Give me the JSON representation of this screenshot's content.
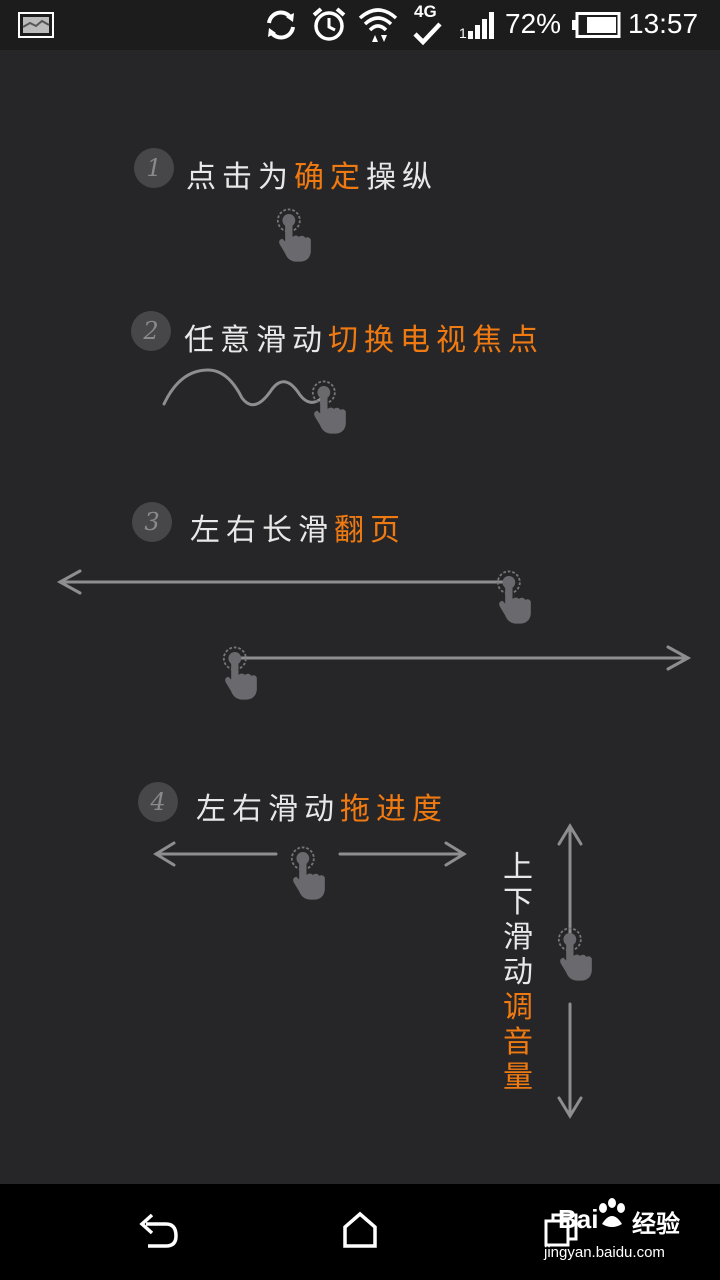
{
  "status_bar": {
    "network": "4G",
    "battery": "72%",
    "time": "13:57",
    "icons": [
      "image-notification-icon",
      "sync-icon",
      "alarm-icon",
      "wifi-icon",
      "4g-data-icon",
      "signal-icon",
      "battery-icon"
    ]
  },
  "steps": [
    {
      "num": "1",
      "text": "点击为",
      "highlight": "确定",
      "suffix": "操纵"
    },
    {
      "num": "2",
      "text": "任意滑动",
      "highlight": "切换电视焦点",
      "suffix": ""
    },
    {
      "num": "3",
      "text": "左右长滑",
      "highlight": "翻页",
      "suffix": ""
    },
    {
      "num": "4",
      "text": "左右滑动",
      "highlight": "拖进度",
      "suffix": ""
    }
  ],
  "volume": {
    "text": [
      "上",
      "下",
      "滑",
      "动"
    ],
    "highlight": [
      "调",
      "音",
      "量"
    ]
  },
  "watermark": {
    "brand": "Bai",
    "brand_suffix": "经验",
    "url": "jingyan.baidu.com"
  },
  "colors": {
    "background": "#262628",
    "accent": "#f07a12",
    "text": "#e8e8e8",
    "gesture": "#8e8e90"
  }
}
